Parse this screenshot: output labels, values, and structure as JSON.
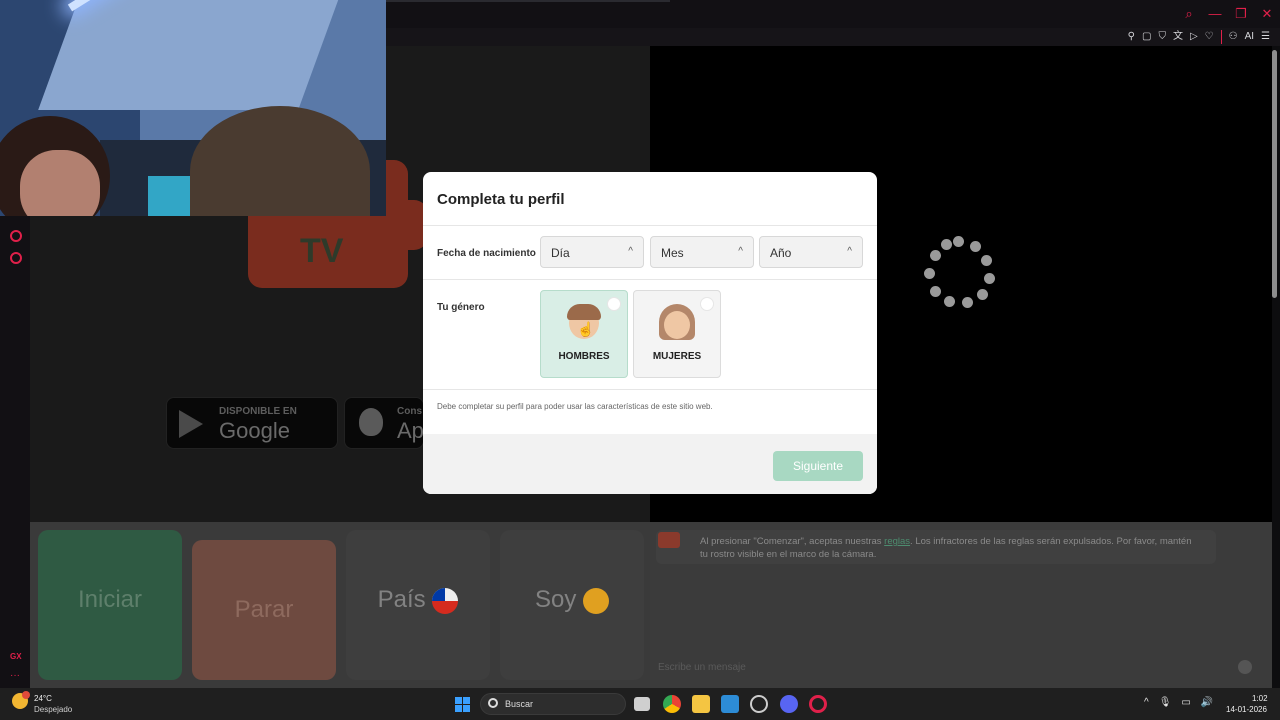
{
  "browser": {
    "window_controls": [
      "search-icon",
      "minimize-icon",
      "restore-icon",
      "close-icon"
    ],
    "toolbar_icons": [
      "bookmark-icon",
      "snapshot-icon",
      "shield-icon",
      "translate-icon",
      "play-icon",
      "heart-icon",
      "account-icon"
    ],
    "ai_label": "AI",
    "accent_color": "#e0204a"
  },
  "background": {
    "store_google_small": "DISPONIBLE EN",
    "store_google_big": "Google Play",
    "store_apple_small": "Cons",
    "store_apple_big": "Ap",
    "logo_text": "TV"
  },
  "modal": {
    "title": "Completa tu perfil",
    "birth_label": "Fecha de nacimiento",
    "day_placeholder": "Día",
    "month_placeholder": "Mes",
    "year_placeholder": "Año",
    "gender_label": "Tu género",
    "gender_male": "HOMBRES",
    "gender_female": "MUJERES",
    "note": "Debe completar su perfil para poder usar las características de este sitio web.",
    "next_button": "Siguiente"
  },
  "controls": {
    "start": "Iniciar",
    "stop": "Parar",
    "country": "País",
    "gender": "Soy"
  },
  "chat": {
    "message_before": "Al presionar \"Comenzar\", aceptas nuestras ",
    "message_link": "reglas",
    "message_after": ". Los infractores de las reglas serán expulsados. Por favor, mantén tu rostro visible en el marco de la cámara.",
    "input_placeholder": "Escribe un mensaje"
  },
  "taskbar": {
    "temperature": "24°C",
    "weather": "Despejado",
    "search_placeholder": "Buscar",
    "time": "1:02",
    "date": "14-01-2026",
    "rail_label": "GX"
  }
}
